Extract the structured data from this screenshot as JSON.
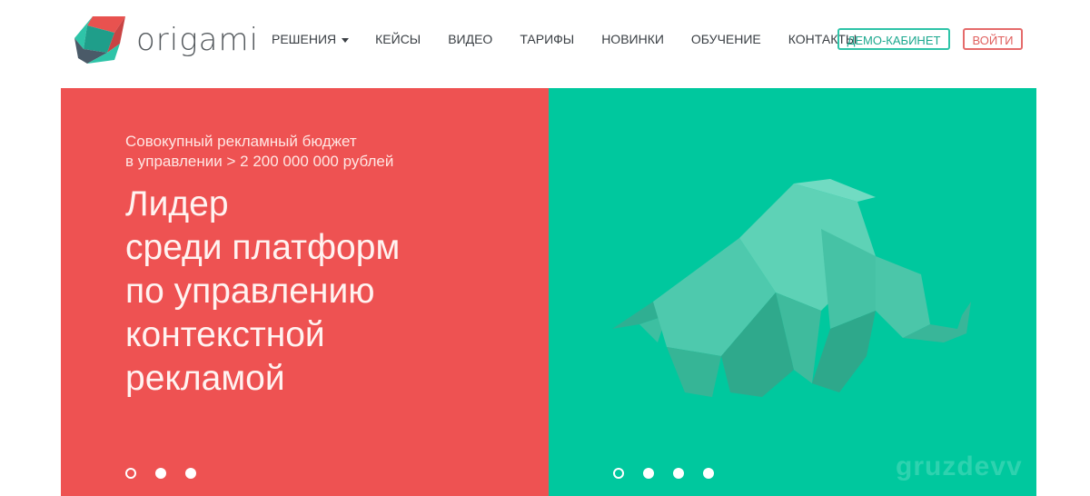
{
  "header": {
    "logo_text": "origami",
    "nav": [
      {
        "label": "Решения",
        "has_dropdown": true
      },
      {
        "label": "Кейсы"
      },
      {
        "label": "Видео"
      },
      {
        "label": "Тарифы"
      },
      {
        "label": "Новинки"
      },
      {
        "label": "Обучение"
      },
      {
        "label": "Контакты"
      }
    ],
    "demo_button": "ДЕМО-КАБИНЕТ",
    "login_button": "ВОЙТИ"
  },
  "hero": {
    "subtitle_line1": "Совокупный рекламный бюджет",
    "subtitle_line2": "в управлении > 2 200 000 000 рублей",
    "headline_lines": [
      "Лидер",
      "среди платформ",
      "по управлению",
      "контекстной",
      "рекламой"
    ],
    "left_dots": [
      "inactive",
      "active",
      "active"
    ],
    "right_dots": [
      "inactive",
      "active",
      "active",
      "active"
    ],
    "watermark": "gruzdevv"
  },
  "colors": {
    "red_panel": "#ee5252",
    "green_panel": "#00c89e",
    "demo_accent": "#2ec4a8",
    "login_accent": "#e56b6b"
  },
  "icons": {
    "logo": "origami-logo-icon",
    "dropdown": "caret-down-icon",
    "illustration": "origami-elephant-icon"
  }
}
